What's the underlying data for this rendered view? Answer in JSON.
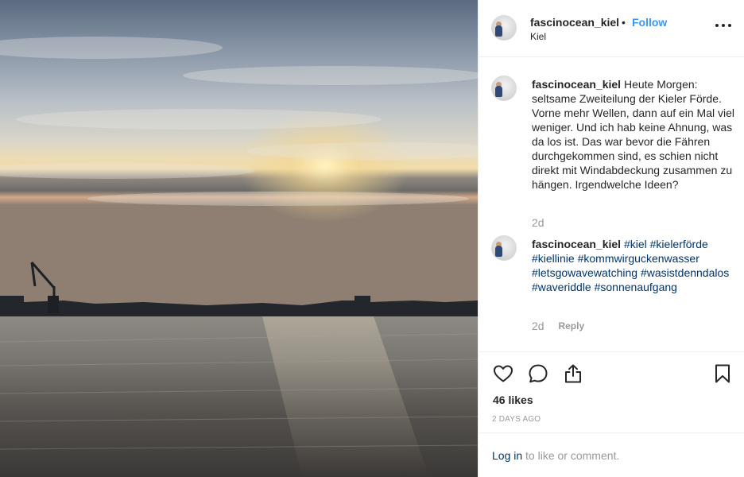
{
  "photo": {
    "alt_icon": "sunset-over-kiel-fjord-photo"
  },
  "header": {
    "username": "fascinocean_kiel",
    "separator": "•",
    "follow_label": "Follow",
    "location": "Kiel",
    "more_icon": "more-options-icon"
  },
  "comments": [
    {
      "username": "fascinocean_kiel",
      "text": "Heute Morgen: seltsame Zweiteilung der Kieler Förde. Vorne mehr Wellen, dann auf ein Mal viel weniger. Und ich hab keine Ahnung, was da los ist. Das war bevor die Fähren durchgekommen sind, es schien nicht direkt mit Windabdeckung zusammen zu hängen. Irgendwelche Ideen?",
      "age": "2d"
    },
    {
      "username": "fascinocean_kiel",
      "hashtags": [
        "#kiel",
        "#kielerförde",
        "#kiellinie",
        "#kommwirguckenwasser",
        "#letsgowavewatching",
        "#wasistdenndalos",
        "#waveriddle",
        "#sonnenaufgang"
      ],
      "age": "2d",
      "reply_label": "Reply"
    }
  ],
  "actions": {
    "like_icon": "heart-icon",
    "comment_icon": "comment-icon",
    "share_icon": "share-icon",
    "save_icon": "bookmark-icon"
  },
  "likes": "46 likes",
  "timestamp": "2 DAYS AGO",
  "login": {
    "link_label": "Log in",
    "suffix": " to like or comment."
  }
}
